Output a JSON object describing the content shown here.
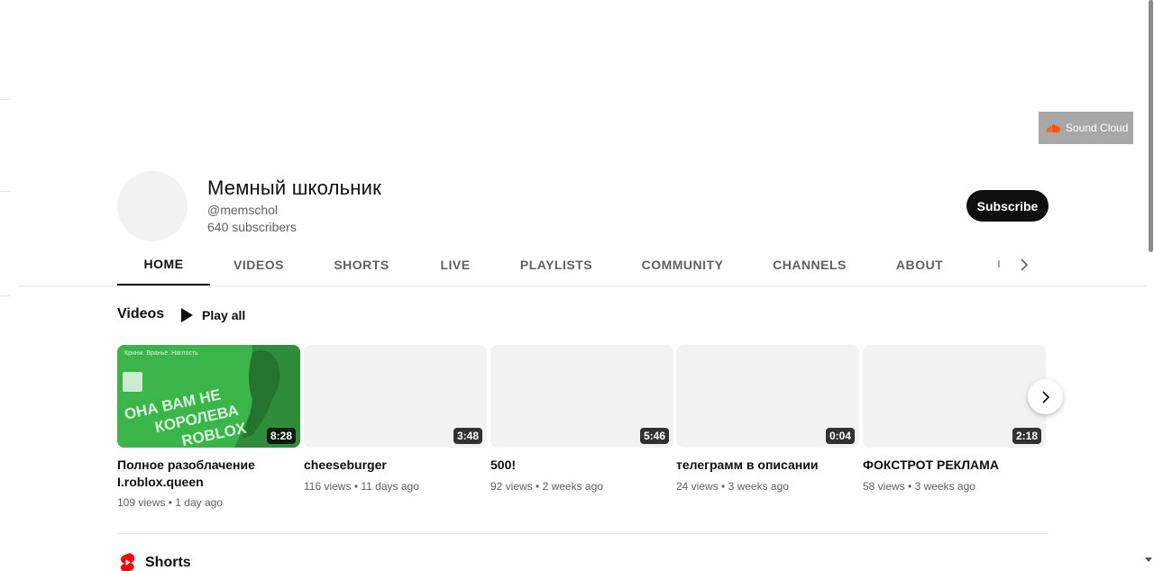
{
  "banner": {
    "link_label": "Sound Cloud",
    "link_icon": "soundcloud-icon"
  },
  "channel": {
    "name": "Мемный школьник",
    "handle": "@memschol",
    "subscribers": "640 subscribers",
    "subscribe_label": "Subscribe"
  },
  "tabs": [
    {
      "label": "HOME",
      "active": true
    },
    {
      "label": "VIDEOS"
    },
    {
      "label": "SHORTS"
    },
    {
      "label": "LIVE"
    },
    {
      "label": "PLAYLISTS"
    },
    {
      "label": "COMMUNITY"
    },
    {
      "label": "CHANNELS"
    },
    {
      "label": "ABOUT"
    }
  ],
  "videos_section": {
    "title": "Videos",
    "play_all_label": "Play all",
    "items": [
      {
        "title": "Полное разоблачение I.roblox.queen",
        "duration": "8:28",
        "views": "109 views",
        "age": "1 day ago",
        "thumbnail": {
          "tagline": "Кринж. Враньё. Наглость",
          "line1": "ОНА ВАМ НЕ",
          "line2": "КОРОЛЕВА",
          "line3": "ROBLOX"
        }
      },
      {
        "title": "cheeseburger",
        "duration": "3:48",
        "views": "116 views",
        "age": "11 days ago"
      },
      {
        "title": "500!",
        "duration": "5:46",
        "views": "92 views",
        "age": "2 weeks ago"
      },
      {
        "title": "телеграмм в описании",
        "duration": "0:04",
        "views": "24 views",
        "age": "3 weeks ago"
      },
      {
        "title": "ФОКСТРОТ РЕКЛАМА",
        "duration": "2:18",
        "views": "58 views",
        "age": "3 weeks ago"
      }
    ],
    "separator": "•"
  },
  "shorts_section": {
    "title": "Shorts",
    "icon": "shorts-icon"
  },
  "colors": {
    "thumb_green": "#32a33f",
    "thumb_dark_green": "#2b8f38",
    "shorts_red": "#ff0000",
    "soundcloud_orange": "#ff5500"
  }
}
